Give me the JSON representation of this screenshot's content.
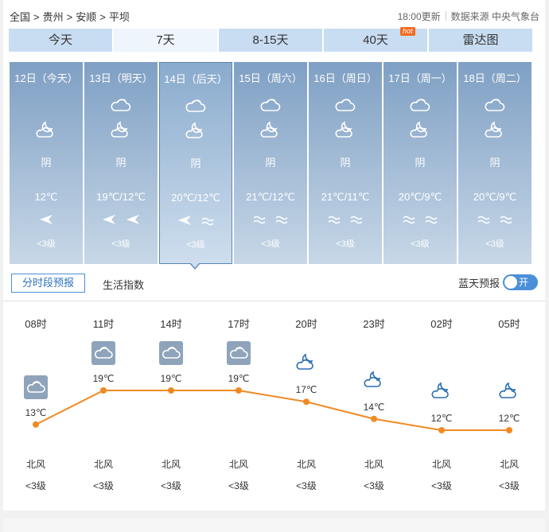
{
  "breadcrumb": {
    "items": [
      "全国",
      "贵州",
      "安顺",
      "平坝"
    ],
    "sep": ">"
  },
  "update_time": "18:00更新",
  "source": "数据来源 中央气象台",
  "tabs": [
    {
      "label": "今天"
    },
    {
      "label": "7天",
      "active": true
    },
    {
      "label": "8-15天"
    },
    {
      "label": "40天",
      "badge": "hot"
    },
    {
      "label": "雷达图"
    }
  ],
  "days": [
    {
      "date": "12日（今天）",
      "icons": [
        "cloudy-night-icon"
      ],
      "weather": "阴",
      "temp": "12℃",
      "winds": [
        "wind-arrow-icon"
      ],
      "level": "<3级"
    },
    {
      "date": "13日（明天）",
      "icons": [
        "cloudy-icon",
        "cloudy-night-icon"
      ],
      "weather": "阴",
      "temp": "19℃/12℃",
      "winds": [
        "wind-arrow-icon",
        "wind-arrow-icon"
      ],
      "level": "<3级"
    },
    {
      "date": "14日（后天）",
      "icons": [
        "cloudy-icon",
        "cloudy-night-icon"
      ],
      "weather": "阴",
      "temp": "20℃/12℃",
      "winds": [
        "wind-arrow-icon",
        "breeze-icon"
      ],
      "level": "<3级",
      "selected": true
    },
    {
      "date": "15日（周六）",
      "icons": [
        "cloudy-icon",
        "cloudy-night-icon"
      ],
      "weather": "阴",
      "temp": "21℃/12℃",
      "winds": [
        "breeze-icon",
        "breeze-icon"
      ],
      "level": "<3级"
    },
    {
      "date": "16日（周日）",
      "icons": [
        "cloudy-icon",
        "cloudy-night-icon"
      ],
      "weather": "阴",
      "temp": "21℃/11℃",
      "winds": [
        "breeze-icon",
        "breeze-icon"
      ],
      "level": "<3级"
    },
    {
      "date": "17日（周一）",
      "icons": [
        "cloudy-icon",
        "cloudy-night-icon"
      ],
      "weather": "阴",
      "temp": "20℃/9℃",
      "winds": [
        "breeze-icon",
        "breeze-icon"
      ],
      "level": "<3级"
    },
    {
      "date": "18日（周二）",
      "icons": [
        "cloudy-icon",
        "cloudy-night-icon"
      ],
      "weather": "阴",
      "temp": "20℃/9℃",
      "winds": [
        "breeze-icon",
        "breeze-icon"
      ],
      "level": "<3级"
    }
  ],
  "subtabs": {
    "hourly": "分时段预报",
    "life": "生活指数"
  },
  "toggle": {
    "label": "蓝天预报",
    "state": "开"
  },
  "hourly": [
    {
      "time": "08时",
      "icon": "cloudy-icon",
      "temp": 13,
      "temp_label": "13℃",
      "wind": "北风",
      "level": "<3级"
    },
    {
      "time": "11时",
      "icon": "cloudy-icon",
      "temp": 19,
      "temp_label": "19℃",
      "wind": "北风",
      "level": "<3级"
    },
    {
      "time": "14时",
      "icon": "cloudy-icon",
      "temp": 19,
      "temp_label": "19℃",
      "wind": "北风",
      "level": "<3级"
    },
    {
      "time": "17时",
      "icon": "cloudy-icon",
      "temp": 19,
      "temp_label": "19℃",
      "wind": "北风",
      "level": "<3级"
    },
    {
      "time": "20时",
      "icon": "cloudy-night-icon",
      "temp": 17,
      "temp_label": "17℃",
      "wind": "北风",
      "level": "<3级"
    },
    {
      "time": "23时",
      "icon": "cloudy-night-icon",
      "temp": 14,
      "temp_label": "14℃",
      "wind": "北风",
      "level": "<3级"
    },
    {
      "time": "02时",
      "icon": "cloudy-night-icon",
      "temp": 12,
      "temp_label": "12℃",
      "wind": "北风",
      "level": "<3级"
    },
    {
      "time": "05时",
      "icon": "cloudy-night-icon",
      "temp": 12,
      "temp_label": "12℃",
      "wind": "北风",
      "level": "<3级"
    }
  ],
  "colors": {
    "line": "#f08a24",
    "tab": "#c8ddf2",
    "tab_active": "#eef5fc",
    "accent": "#4a90d9",
    "icon_blue": "#2a6fb0"
  }
}
